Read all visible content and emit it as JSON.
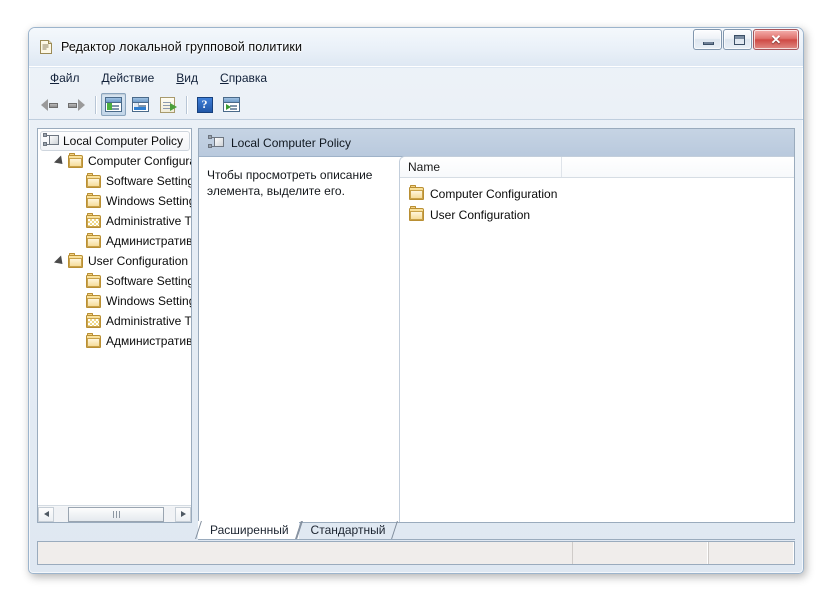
{
  "window": {
    "title": "Редактор локальной групповой политики",
    "title_icon": "document-policy-icon",
    "controls": {
      "minimize": "minimize-button",
      "maximize": "maximize-button",
      "close_label": "✕"
    }
  },
  "menubar": {
    "items": [
      {
        "label": "Файл",
        "mnemonic": "Ф"
      },
      {
        "label": "Действие",
        "mnemonic": "Д"
      },
      {
        "label": "Вид",
        "mnemonic": "В"
      },
      {
        "label": "Справка",
        "mnemonic": "С"
      }
    ]
  },
  "toolbar": {
    "buttons": [
      {
        "name": "back-button",
        "icon": "arrow-left-icon",
        "pressed": false
      },
      {
        "name": "forward-button",
        "icon": "arrow-right-icon",
        "pressed": false
      },
      {
        "name": "show-hide-tree-button",
        "icon": "console-tree-icon",
        "pressed": true
      },
      {
        "name": "properties-button",
        "icon": "properties-window-icon",
        "pressed": false
      },
      {
        "name": "export-list-button",
        "icon": "export-document-icon",
        "pressed": false
      },
      {
        "name": "help-button",
        "icon": "question-mark-icon",
        "pressed": false
      },
      {
        "name": "show-action-pane-button",
        "icon": "action-pane-icon",
        "pressed": false
      }
    ],
    "help_glyph": "?"
  },
  "tree": {
    "root": {
      "label": "Local Computer Policy",
      "icon": "local-policy-icon",
      "selected": true
    },
    "nodes": [
      {
        "label": "Computer Configura",
        "icon": "folder-icon",
        "indent": 1,
        "state": "open"
      },
      {
        "label": "Software Settings",
        "icon": "folder-icon",
        "indent": 2,
        "state": "closed"
      },
      {
        "label": "Windows Setting",
        "icon": "folder-icon",
        "indent": 2,
        "state": "closed"
      },
      {
        "label": "Administrative Te",
        "icon": "folder-template-icon",
        "indent": 2,
        "state": "closed"
      },
      {
        "label": "Административн",
        "icon": "folder-icon",
        "indent": 2,
        "state": "closed"
      },
      {
        "label": "User Configuration",
        "icon": "folder-icon",
        "indent": 1,
        "state": "open"
      },
      {
        "label": "Software Settings",
        "icon": "folder-icon",
        "indent": 2,
        "state": "closed"
      },
      {
        "label": "Windows Setting",
        "icon": "folder-icon",
        "indent": 2,
        "state": "closed"
      },
      {
        "label": "Administrative Te",
        "icon": "folder-template-icon",
        "indent": 2,
        "state": "closed"
      },
      {
        "label": "Административн",
        "icon": "folder-icon",
        "indent": 2,
        "state": "closed"
      }
    ],
    "scrollbar": {
      "left_arrow": "scroll-left-arrow",
      "right_arrow": "scroll-right-arrow"
    }
  },
  "right_pane": {
    "header_title": "Local Computer Policy",
    "header_icon": "local-policy-icon",
    "description": "Чтобы просмотреть описание элемента, выделите его.",
    "list": {
      "columns": [
        "Name",
        ""
      ],
      "rows": [
        {
          "name": "Computer Configuration",
          "icon": "folder-icon"
        },
        {
          "name": "User Configuration",
          "icon": "folder-icon"
        }
      ]
    }
  },
  "tabs": [
    {
      "label": "Расширенный",
      "active": true
    },
    {
      "label": "Стандартный",
      "active": false
    }
  ],
  "statusbar": {
    "panes": [
      "",
      "",
      ""
    ]
  },
  "colors": {
    "title_bar": "#e9f0f8",
    "pane_header": "#bfcee0",
    "accent_folder": "#e9c264",
    "close_button": "#cf4a45",
    "window_border": "#9cb4cc"
  }
}
